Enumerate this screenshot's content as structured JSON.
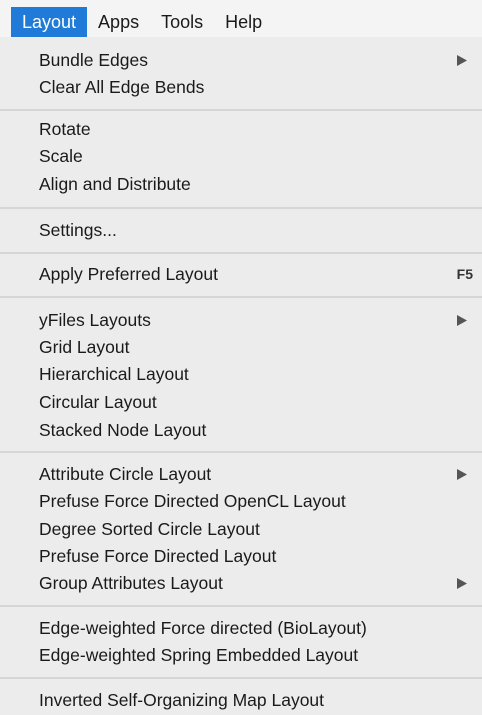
{
  "menubar": {
    "items": [
      "Layout",
      "Apps",
      "Tools",
      "Help"
    ]
  },
  "menu": {
    "bundle_edges": "Bundle Edges",
    "clear_all_edge_bends": "Clear All Edge Bends",
    "rotate": "Rotate",
    "scale": "Scale",
    "align_and_distribute": "Align and Distribute",
    "settings": "Settings...",
    "apply_preferred_layout": "Apply Preferred Layout",
    "apply_preferred_layout_shortcut": "F5",
    "yfiles_layouts": "yFiles Layouts",
    "grid_layout": "Grid Layout",
    "hierarchical_layout": "Hierarchical Layout",
    "circular_layout": "Circular Layout",
    "stacked_node_layout": "Stacked Node Layout",
    "attribute_circle_layout": "Attribute Circle Layout",
    "prefuse_force_directed_opencl_layout": "Prefuse Force Directed OpenCL Layout",
    "degree_sorted_circle_layout": "Degree Sorted Circle Layout",
    "prefuse_force_directed_layout": "Prefuse Force Directed Layout",
    "group_attributes_layout": "Group Attributes Layout",
    "edge_weighted_force_directed": "Edge-weighted Force directed (BioLayout)",
    "edge_weighted_spring_embedded": "Edge-weighted Spring Embedded Layout",
    "inverted_self_organizing_map": "Inverted Self-Organizing Map Layout"
  },
  "icons": {
    "submenu_arrow": "chevron-right-icon"
  },
  "colors": {
    "accent": "#1f7ad8",
    "menu_background": "#ececec",
    "menubar_background": "#f4f4f4",
    "separator": "#d6d6d6"
  }
}
